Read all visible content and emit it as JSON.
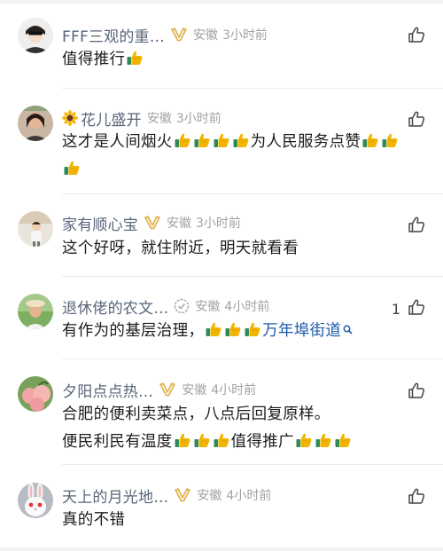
{
  "comments": [
    {
      "name": "FFF三观的重…",
      "badge": "vip-badge-icon",
      "location": "安徽",
      "time": "3小时前",
      "text": "值得推行",
      "trail_thumbs": 1,
      "likes": ""
    },
    {
      "name_prefix_icon": "sunflower-icon",
      "name": "花儿盛开",
      "location": "安徽",
      "time": "3小时前",
      "text_parts": [
        "这才是人间烟火",
        "为人民服务点赞"
      ],
      "thumbs_after": [
        4,
        2
      ],
      "line2_thumbs": 1,
      "likes": ""
    },
    {
      "name": "家有顺心宝",
      "badge": "vip-badge-icon",
      "location": "安徽",
      "time": "3小时前",
      "text": "这个好呀，就住附近，明天就看看",
      "likes": ""
    },
    {
      "name": "退休佬的农文…",
      "badge": "verified-badge-icon",
      "location": "安徽",
      "time": "4小时前",
      "text": "有作为的基层治理，",
      "thumbs": 3,
      "link": "万年埠街道",
      "likes": "1"
    },
    {
      "name": "夕阳点点热…",
      "badge": "vip-badge-icon",
      "location": "安徽",
      "time": "4小时前",
      "line1": "合肥的便利卖菜点，八点后回复原样。",
      "line2_parts": [
        "便民利民有温度",
        "值得推广"
      ],
      "line2_thumbs": [
        3,
        3
      ],
      "likes": ""
    },
    {
      "name": "天上的月光地…",
      "badge": "vip-badge-icon",
      "location": "安徽",
      "time": "4小时前",
      "text": "真的不错",
      "likes": ""
    }
  ],
  "colors": {
    "name": "#59657a",
    "meta": "#a2a2a2",
    "text": "#1c1c1c",
    "link": "#1d5aa8",
    "thumb": "#f2b400",
    "badge": "#e0b450"
  }
}
